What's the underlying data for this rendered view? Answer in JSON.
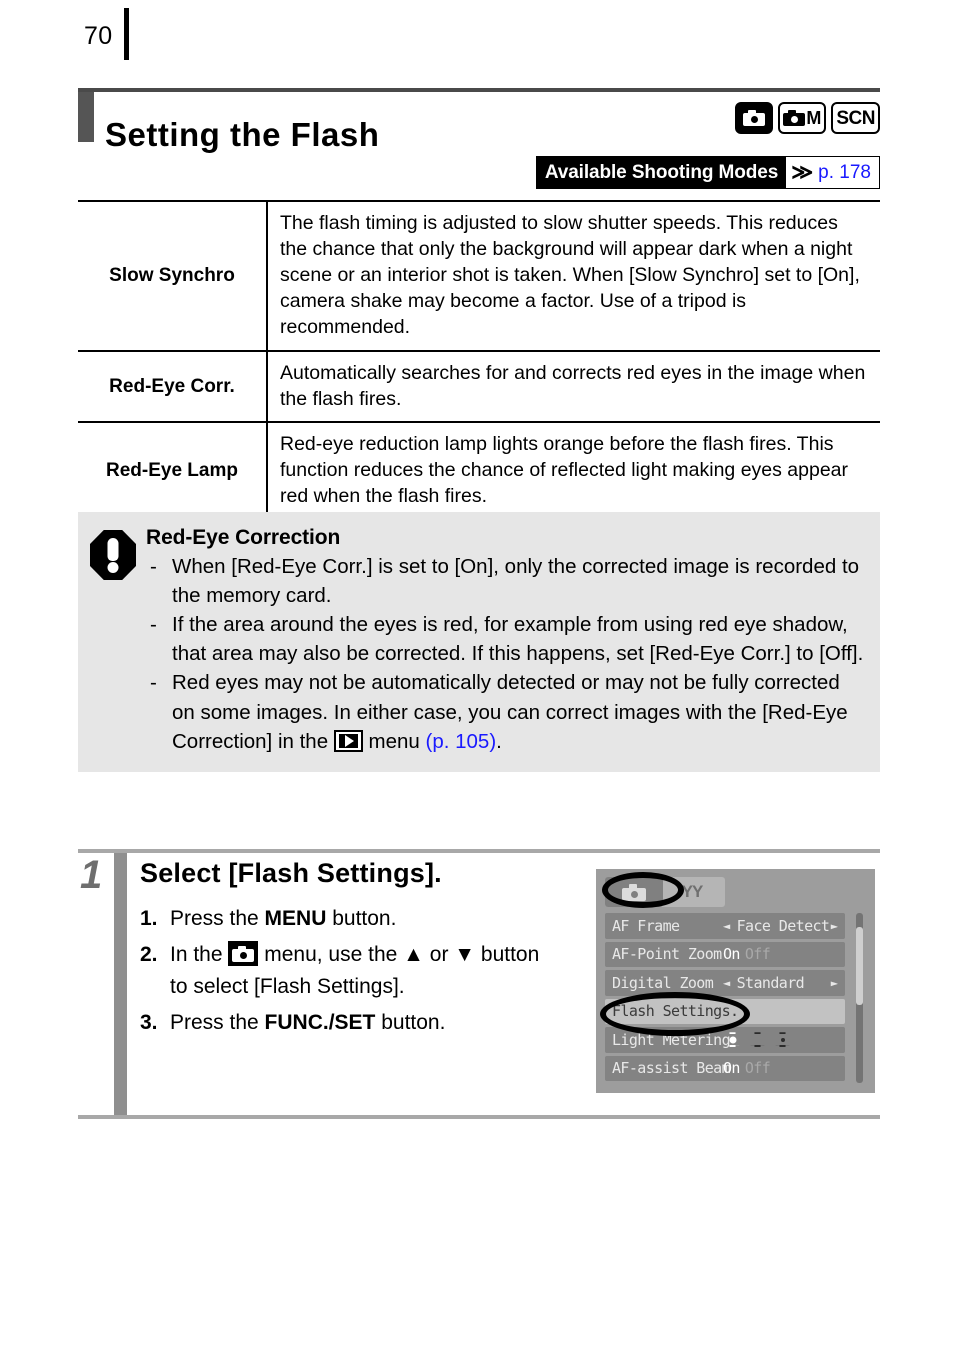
{
  "page": {
    "number": "70"
  },
  "section": {
    "title": "Setting the Flash",
    "mode_icons": [
      {
        "name": "auto-mode-icon",
        "label": ""
      },
      {
        "name": "manual-mode-icon",
        "label": "M"
      },
      {
        "name": "scene-mode-icon",
        "label": "SCN"
      }
    ]
  },
  "available_modes_banner": {
    "label": "Available Shooting Modes",
    "chevron": "≫",
    "page_ref": "p. 178",
    "link_color": "#1a1aff"
  },
  "spec_table": {
    "rows": [
      {
        "name": "Slow Synchro",
        "description": "The flash timing is adjusted to slow shutter speeds. This reduces the chance that only the background will appear dark when a night scene or an interior shot is taken. When [Slow Synchro] set to [On], camera shake may become a factor. Use of a tripod is recommended."
      },
      {
        "name": "Red-Eye Corr.",
        "description": "Automatically searches for and corrects red eyes in the image when the flash fires."
      },
      {
        "name": "Red-Eye Lamp",
        "description": "Red-eye reduction lamp lights orange before the flash fires. This function reduces the chance of reflected light making eyes appear red when the flash fires."
      }
    ]
  },
  "note": {
    "title": "Red-Eye Correction",
    "bullets": [
      {
        "dash": "-",
        "text": "When [Red-Eye Corr.] is set to [On], only the corrected image is recorded to the memory card."
      },
      {
        "dash": "-",
        "text": "If the area around the eyes is red, for example from using red eye shadow, that area may also be corrected. If this happens, set [Red-Eye Corr.] to [Off]."
      },
      {
        "dash": "-",
        "text_before": "Red eyes may not be automatically detected or may not be fully corrected on some images. In either case, you can correct images with the [Red-Eye Correction] in the",
        "text_after": "menu",
        "page_ref": "(p. 105)",
        "period": "."
      }
    ]
  },
  "step": {
    "number": "1",
    "heading": "Select [Flash Settings].",
    "items": [
      {
        "index": "1.",
        "before": "Press the ",
        "bold": "MENU",
        "after": " button."
      },
      {
        "index": "2.",
        "before": "In the ",
        "mid": " menu, use the ▲ or ▼ button to select [Flash Settings]."
      },
      {
        "index": "3.",
        "before": "Press the ",
        "bold": "FUNC./SET",
        "after": " button."
      }
    ]
  },
  "lcd": {
    "tabs": [
      {
        "name": "shooting-tab",
        "icon": "camera-icon",
        "active": true
      },
      {
        "name": "setup-tab",
        "icon": "wrench-icon",
        "glyph": "ΥΥ",
        "active": false
      }
    ],
    "rows": [
      {
        "label": "AF Frame",
        "value": "Face Detect",
        "style": "arrows"
      },
      {
        "label": "AF-Point Zoom",
        "on": "On",
        "off": "Off",
        "style": "onoff"
      },
      {
        "label": "Digital Zoom",
        "value": "Standard",
        "style": "arrows"
      },
      {
        "label": "Flash Settings.",
        "value": "",
        "style": "selected"
      },
      {
        "label": "Light Metering",
        "value": "",
        "style": "metering"
      },
      {
        "label": "AF-assist Beam",
        "on": "On",
        "off": "Off",
        "style": "onoff"
      }
    ]
  }
}
